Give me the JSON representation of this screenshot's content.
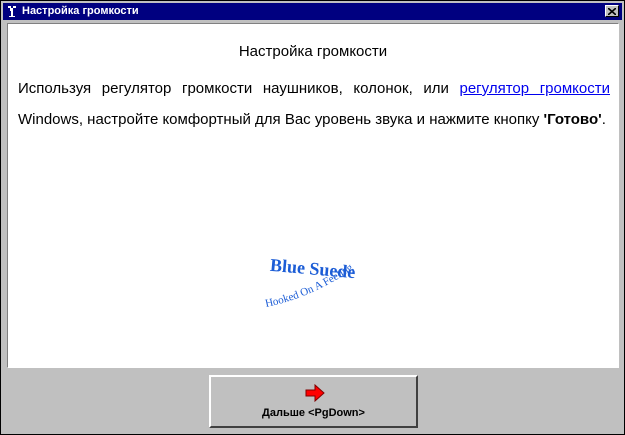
{
  "window": {
    "title": "Настройка громкости"
  },
  "content": {
    "heading": "Настройка громкости",
    "para_part1": "Используя регулятор громкости наушников, колонок, или ",
    "link_text": "регулятор громкости",
    "para_part2": " Windows, настройте комфортный для Вас уровень звука и нажмите кнопку ",
    "bold_word": "'Готово'",
    "para_end": "."
  },
  "logo": {
    "main_text": "Blue Suede",
    "arc_text": "Hooked On A Feeling"
  },
  "footer": {
    "next_label": "Дальше <PgDown>"
  },
  "icons": {
    "window": "app-icon",
    "close": "close-icon",
    "next": "arrow-right-icon"
  },
  "colors": {
    "titlebar": "#000080",
    "link": "#0000ee",
    "logo": "#1c5dd6",
    "arrow": "#ff0000"
  }
}
